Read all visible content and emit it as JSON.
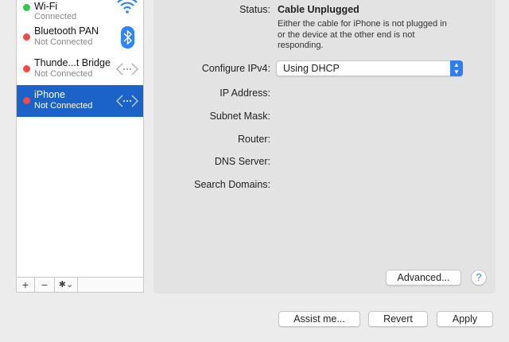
{
  "services": [
    {
      "name": "Wi-Fi",
      "status": "Connected",
      "status_color": "#34c748",
      "icon": "wifi-icon"
    },
    {
      "name": "Bluetooth PAN",
      "status": "Not Connected",
      "status_color": "#f24a45",
      "icon": "bluetooth-icon"
    },
    {
      "name": "Thunde...t Bridge",
      "status": "Not Connected",
      "status_color": "#f24a45",
      "icon": "ethernet-icon"
    },
    {
      "name": "iPhone",
      "status": "Not Connected",
      "status_color": "#f24a45",
      "icon": "ethernet-icon",
      "selected": true
    }
  ],
  "list_bar": {
    "add": "+",
    "remove": "−",
    "gear": "✱⌄"
  },
  "detail": {
    "status_label": "Status:",
    "status_value": "Cable Unplugged",
    "status_desc": [
      "Either the cable for iPhone is not plugged in",
      "or the device at the other end is not",
      "responding."
    ],
    "configure_label": "Configure IPv4:",
    "configure_value": "Using DHCP",
    "ip_label": "IP Address:",
    "subnet_label": "Subnet Mask:",
    "router_label": "Router:",
    "dns_label": "DNS Server:",
    "search_label": "Search Domains:",
    "advanced": "Advanced...",
    "help": "?"
  },
  "footer": {
    "assist": "Assist me...",
    "revert": "Revert",
    "apply": "Apply"
  }
}
